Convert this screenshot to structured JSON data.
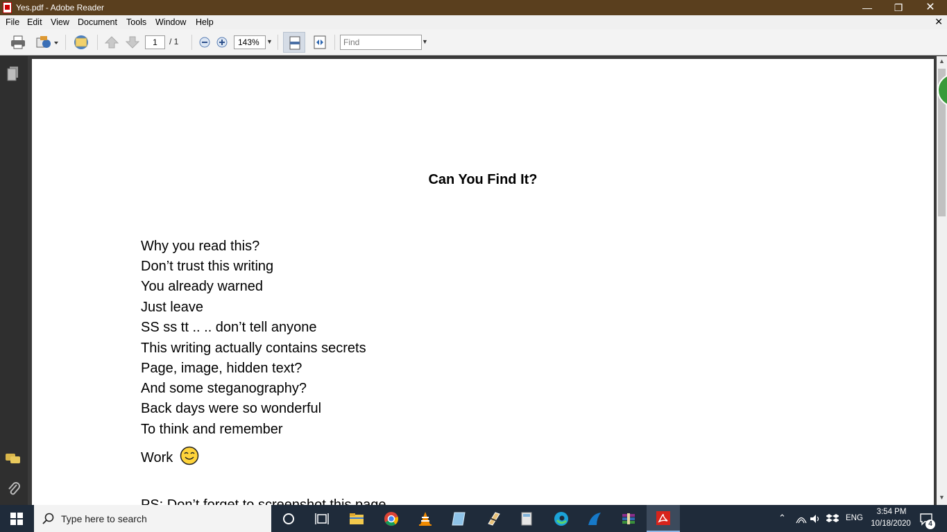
{
  "window": {
    "title": "Yes.pdf - Adobe Reader"
  },
  "menu": [
    "File",
    "Edit",
    "View",
    "Document",
    "Tools",
    "Window",
    "Help"
  ],
  "toolbar": {
    "page_current": "1",
    "page_total": "/ 1",
    "zoom": "143%",
    "find_placeholder": "Find"
  },
  "document": {
    "title": "Can You Find It?",
    "lines": [
      "Why you read this?",
      "Don’t trust this writing",
      "You already warned",
      "Just leave",
      "SS ss tt .. .. don’t tell anyone",
      "This writing actually contains secrets",
      "Page, image, hidden text?",
      "And some steganography?",
      "Back days were so wonderful",
      "To think and remember",
      "Work"
    ],
    "cutoff_line": "PS: Don’t forget to screenshot this page"
  },
  "taskbar": {
    "search_placeholder": "Type here to search",
    "language": "ENG",
    "time": "3:54 PM",
    "date": "10/18/2020",
    "notifications": "4"
  }
}
